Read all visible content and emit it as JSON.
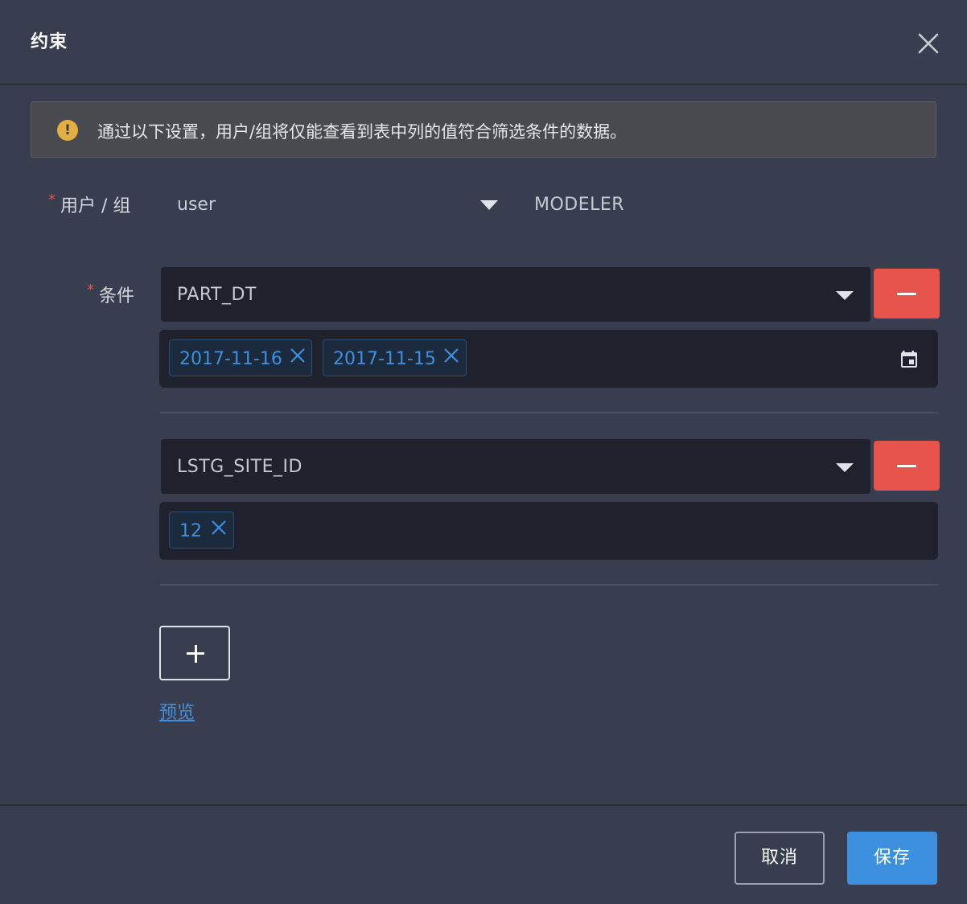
{
  "dialog": {
    "title": "约束",
    "close_icon": "close-icon"
  },
  "alert": {
    "icon": "warning-icon",
    "icon_glyph": "!",
    "text": "通过以下设置，用户/组将仅能查看到表中列的值符合筛选条件的数据。",
    "color": "#e0ae42"
  },
  "form": {
    "required_mark": "*",
    "user_group": {
      "label": "用户 / 组",
      "type_value": "user",
      "name_value": "MODELER"
    },
    "conditions": {
      "label": "条件",
      "items": [
        {
          "column": "PART_DT",
          "values": [
            "2017-11-16",
            "2017-11-15"
          ],
          "has_calendar": true
        },
        {
          "column": "LSTG_SITE_ID",
          "values": [
            "12"
          ],
          "has_calendar": false
        }
      ]
    },
    "add_symbol": "+",
    "preview_link": "预览"
  },
  "footer": {
    "cancel_label": "取消",
    "save_label": "保存"
  },
  "colors": {
    "background": "#383e4f",
    "danger": "#e5534b",
    "primary": "#3d8fe0"
  }
}
